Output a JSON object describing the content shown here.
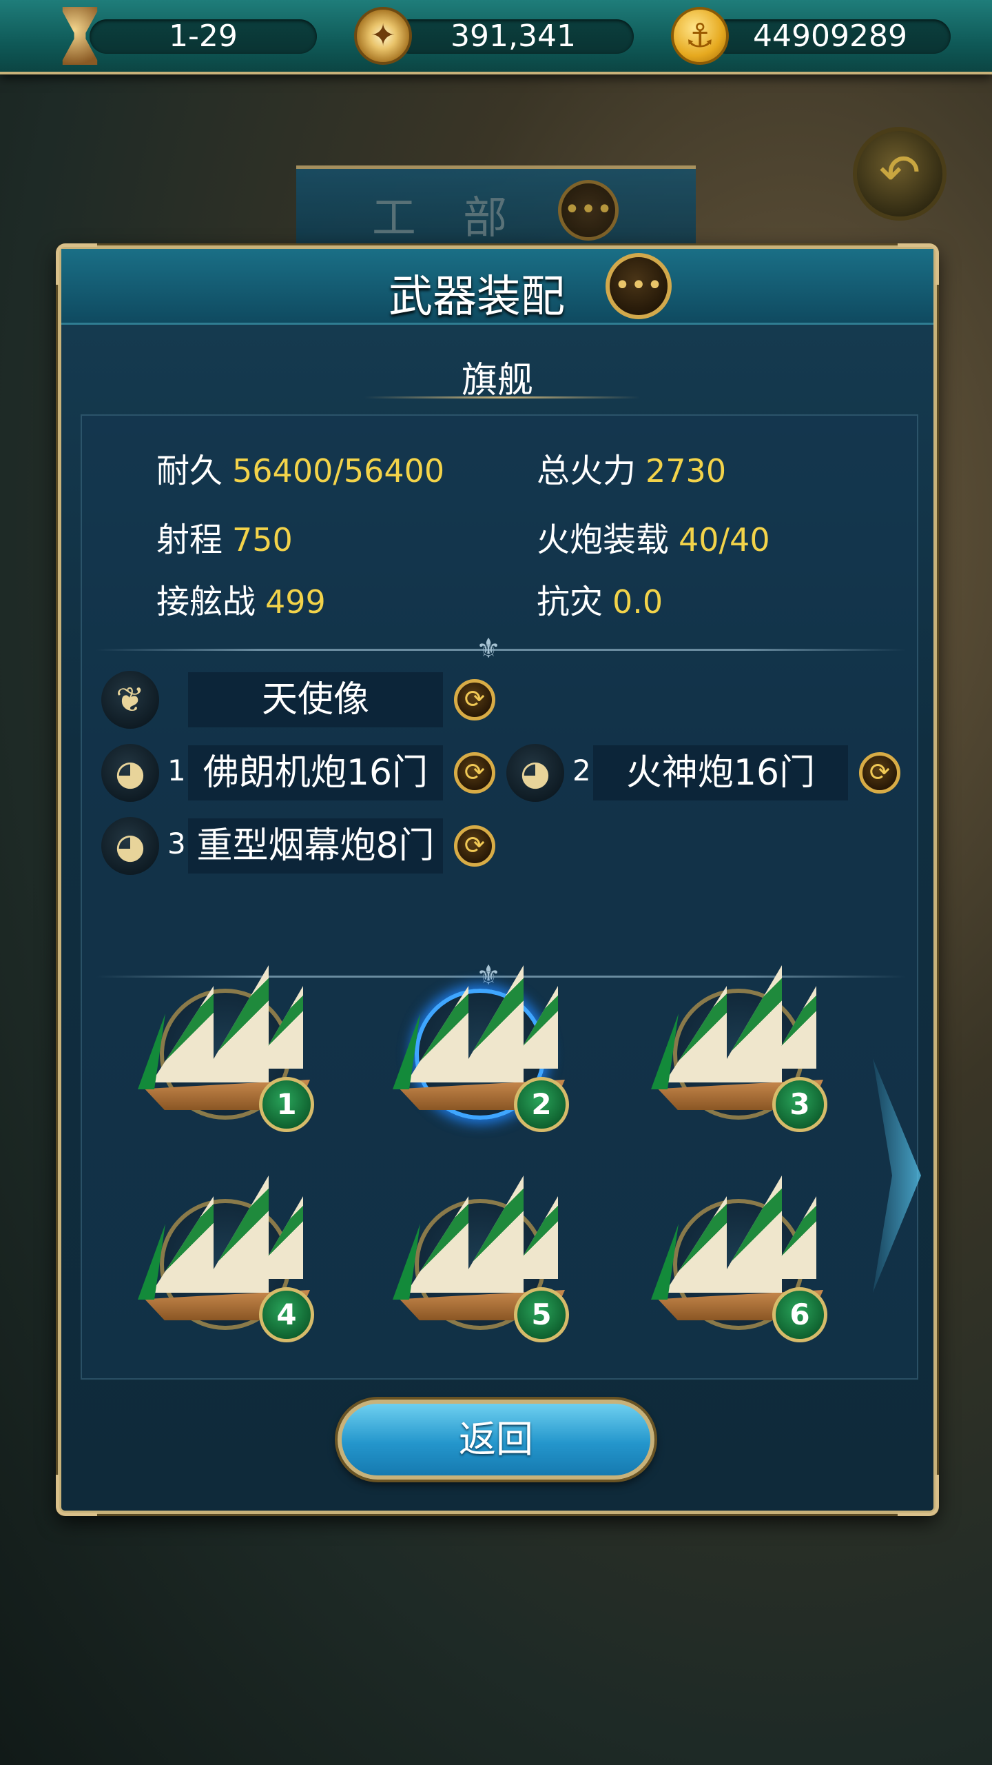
{
  "topbar": {
    "date": "1-29",
    "compass_value": "391,341",
    "gold_value": "44909289",
    "icons": [
      "hourglass-icon",
      "compass-icon",
      "gold-coin-icon"
    ]
  },
  "background": {
    "department_title": "工 部",
    "back_icon": "back-arrow-icon"
  },
  "panel": {
    "title": "武器装配",
    "subtitle": "旗舰",
    "stats": {
      "durability_label": "耐久",
      "durability_value": "56400/56400",
      "firepower_label": "总火力",
      "firepower_value": "2730",
      "range_label": "射程",
      "range_value": "750",
      "cannon_load_label": "火炮装载",
      "cannon_load_value": "40/40",
      "boarding_label": "接舷战",
      "boarding_value": "499",
      "disaster_label": "抗灾",
      "disaster_value": "0.0"
    },
    "figurehead": {
      "name": "天使像",
      "icon": "angel-wing-icon"
    },
    "cannons": [
      {
        "num": "1",
        "name": "佛朗机炮16门",
        "icon": "cannon-icon"
      },
      {
        "num": "2",
        "name": "火神炮16门",
        "icon": "cannon-icon"
      },
      {
        "num": "3",
        "name": "重型烟幕炮8门",
        "icon": "cannon-icon"
      }
    ],
    "ships": [
      {
        "num": "1",
        "selected": false
      },
      {
        "num": "2",
        "selected": true
      },
      {
        "num": "3",
        "selected": false
      },
      {
        "num": "4",
        "selected": false
      },
      {
        "num": "5",
        "selected": false
      },
      {
        "num": "6",
        "selected": false
      }
    ],
    "return_label": "返回"
  },
  "colors": {
    "accent_gold": "#c8b27a",
    "value_yellow": "#f3d34a",
    "panel_blue": "#163c52",
    "selected_ring": "#3fa6ff"
  }
}
